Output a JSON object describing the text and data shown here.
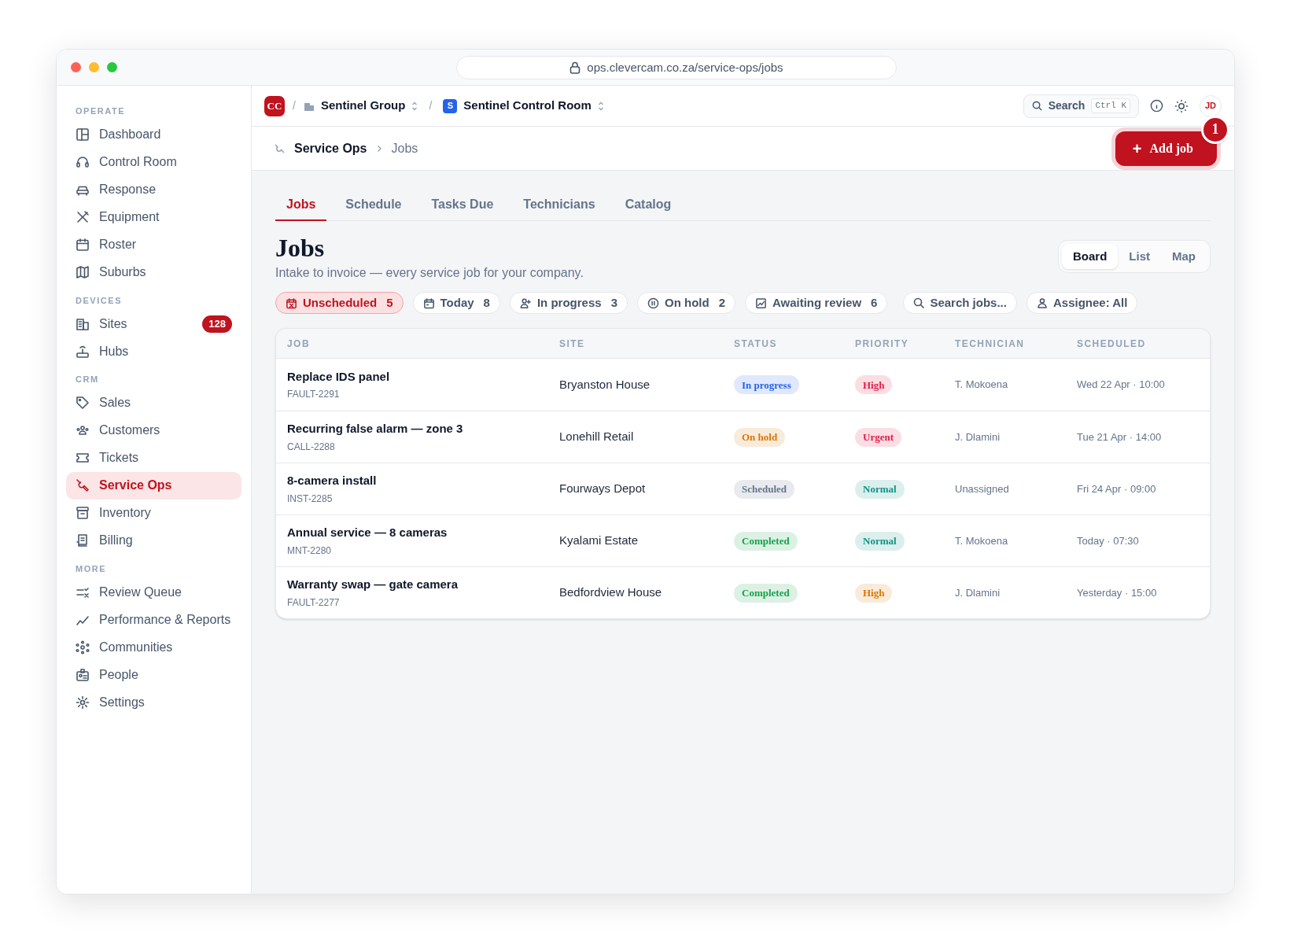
{
  "browser": {
    "url": "ops.clevercam.co.za/service-ops/jobs"
  },
  "sidebar": {
    "sections": [
      {
        "heading": "OPERATE",
        "items": [
          {
            "label": "Dashboard",
            "selected": false
          },
          {
            "label": "Control Room",
            "selected": false
          },
          {
            "label": "Response",
            "selected": false
          },
          {
            "label": "Equipment",
            "selected": false
          },
          {
            "label": "Roster",
            "selected": false
          },
          {
            "label": "Suburbs",
            "selected": false
          }
        ]
      },
      {
        "heading": "DEVICES",
        "items": [
          {
            "label": "Sites",
            "selected": false,
            "badge": "128"
          },
          {
            "label": "Hubs",
            "selected": false
          }
        ]
      },
      {
        "heading": "CRM",
        "items": [
          {
            "label": "Sales",
            "selected": false
          },
          {
            "label": "Customers",
            "selected": false
          },
          {
            "label": "Tickets",
            "selected": false
          },
          {
            "label": "Service Ops",
            "selected": true
          },
          {
            "label": "Inventory",
            "selected": false
          },
          {
            "label": "Billing",
            "selected": false
          }
        ]
      },
      {
        "heading": "MORE",
        "items": [
          {
            "label": "Review Queue",
            "selected": false
          },
          {
            "label": "Performance & Reports",
            "selected": false
          },
          {
            "label": "Communities",
            "selected": false
          },
          {
            "label": "People",
            "selected": false
          },
          {
            "label": "Settings",
            "selected": false
          }
        ]
      }
    ]
  },
  "topbar": {
    "separators": [
      "/",
      "/"
    ],
    "logo": "CC",
    "org": "Sentinel Group",
    "workspace_badge": "S",
    "workspace": "Sentinel Control Room",
    "search": "Search",
    "shortcut": "Ctrl K",
    "avatar": "JD"
  },
  "breadcrumb": [
    "Service Ops",
    "Jobs"
  ],
  "add_button": {
    "label": "Add job",
    "plus": "+",
    "notification": "1"
  },
  "tabs": [
    {
      "label": "Jobs",
      "selected": true
    },
    {
      "label": "Schedule",
      "selected": false
    },
    {
      "label": "Tasks Due",
      "selected": false
    },
    {
      "label": "Technicians",
      "selected": false
    },
    {
      "label": "Catalog",
      "selected": false
    }
  ],
  "title": "Jobs",
  "subtitle": "Intake to invoice — every service job for your company.",
  "views": [
    {
      "label": "Board",
      "selected": true
    },
    {
      "label": "List",
      "selected": false
    },
    {
      "label": "Map",
      "selected": false
    }
  ],
  "filters": [
    {
      "label": "Unscheduled",
      "count": "5",
      "selected": true
    },
    {
      "label": "Today",
      "count": "8",
      "selected": false
    },
    {
      "label": "In progress",
      "count": "3",
      "selected": false
    },
    {
      "label": "On hold",
      "count": "2",
      "selected": false
    },
    {
      "label": "Awaiting review",
      "count": "6",
      "selected": false
    }
  ],
  "search_jobs": "Search jobs...",
  "assignee": "Assignee: All",
  "table": {
    "columns": [
      "JOB",
      "SITE",
      "STATUS",
      "PRIORITY",
      "TECHNICIAN",
      "SCHEDULED"
    ],
    "rows": [
      {
        "job": "Replace IDS panel",
        "ref": "FAULT-2291",
        "site": "Bryanston House",
        "status": {
          "label": "In progress",
          "color": "#2563eb"
        },
        "priority": {
          "label": "High",
          "color": "#e11d48"
        },
        "technician": "T. Mokoena",
        "scheduled": "Wed 22 Apr · 10:00"
      },
      {
        "job": "Recurring false alarm — zone 3",
        "ref": "CALL-2288",
        "site": "Lonehill Retail",
        "status": {
          "label": "On hold",
          "color": "#d97706"
        },
        "priority": {
          "label": "Urgent",
          "color": "#e11d48"
        },
        "technician": "J. Dlamini",
        "scheduled": "Tue 21 Apr · 14:00"
      },
      {
        "job": "8-camera install",
        "ref": "INST-2285",
        "site": "Fourways Depot",
        "status": {
          "label": "Scheduled",
          "color": "#64748b"
        },
        "priority": {
          "label": "Normal",
          "color": "#0d9488"
        },
        "technician": "Unassigned",
        "scheduled": "Fri 24 Apr · 09:00"
      },
      {
        "job": "Annual service — 8 cameras",
        "ref": "MNT-2280",
        "site": "Kyalami Estate",
        "status": {
          "label": "Completed",
          "color": "#16a34a"
        },
        "priority": {
          "label": "Normal",
          "color": "#0d9488"
        },
        "technician": "T. Mokoena",
        "scheduled": "Today · 07:30"
      },
      {
        "job": "Warranty swap — gate camera",
        "ref": "FAULT-2277",
        "site": "Bedfordview House",
        "status": {
          "label": "Completed",
          "color": "#16a34a"
        },
        "priority": {
          "label": "High",
          "color": "#d97706"
        },
        "technician": "J. Dlamini",
        "scheduled": "Yesterday · 15:00"
      }
    ]
  }
}
